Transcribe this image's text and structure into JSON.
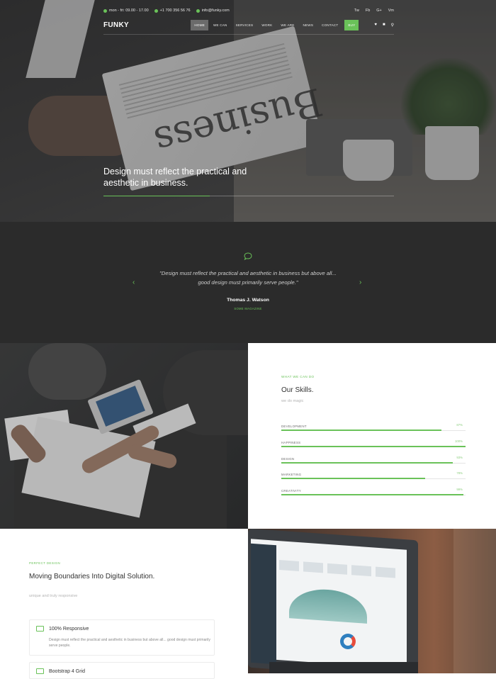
{
  "topbar": {
    "hours": "mon - fri: 09.00 - 17.00",
    "phone": "+1 700 356 56 76",
    "email": "info@funky.com",
    "socials": [
      "Tw",
      "Fb",
      "G+",
      "Vm"
    ]
  },
  "nav": {
    "logo": "FUNKY",
    "items": [
      "HOME",
      "WE CAN",
      "SERVICES",
      "WORK",
      "WE ARE",
      "NEWS",
      "CONTACT"
    ],
    "buy": "BUY",
    "icons": [
      "heart-icon",
      "bag-icon",
      "search-icon"
    ]
  },
  "hero": {
    "title": "Design must reflect the practical and aesthetic in business."
  },
  "testimonial": {
    "quote": "\"Design must reflect the practical and aesthetic in business but above all... good design must primarily serve people.\"",
    "name": "Thomas J. Watson",
    "role": "SOME MAGAZINE",
    "prev": "‹",
    "next": "›"
  },
  "skills": {
    "eyebrow": "WHAT WE CAN DO",
    "title": "Our Skills.",
    "subtitle": "we do magic",
    "items": [
      {
        "label": "DEVELOPMENT",
        "pct": "87%",
        "value": 87
      },
      {
        "label": "HAPPINESS",
        "pct": "100%",
        "value": 100
      },
      {
        "label": "DESIGN",
        "pct": "93%",
        "value": 93
      },
      {
        "label": "MARKETING",
        "pct": "78%",
        "value": 78
      },
      {
        "label": "CREATIVITY",
        "pct": "99%",
        "value": 99
      }
    ]
  },
  "feature": {
    "eyebrow": "PERFECT DESIGN",
    "title": "Moving Boundaries Into Digital Solution.",
    "subtitle": "unique and truly responsive",
    "cards": [
      {
        "title": "100% Responsive",
        "text": "Design must reflect the practical and aesthetic in business but above all... good design must primarily serve people."
      },
      {
        "title": "Bootstrap 4 Grid",
        "text": ""
      }
    ]
  },
  "colors": {
    "accent": "#6ac259",
    "dark": "#2b2b2b"
  }
}
